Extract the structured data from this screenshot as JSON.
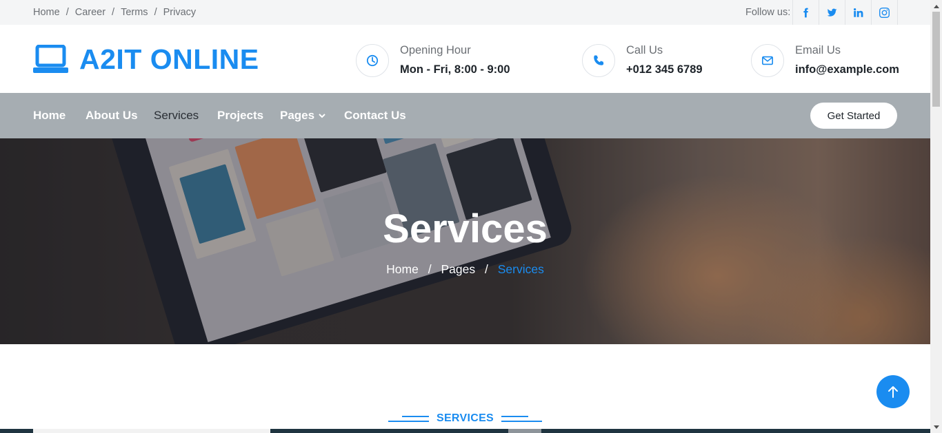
{
  "topbar": {
    "links": [
      "Home",
      "Career",
      "Terms",
      "Privacy"
    ],
    "separator": "/",
    "follow_label": "Follow us:",
    "social": [
      "facebook-icon",
      "twitter-icon",
      "linkedin-icon",
      "instagram-icon"
    ]
  },
  "header": {
    "brand": "A2IT ONLINE",
    "opening": {
      "label": "Opening Hour",
      "value": "Mon - Fri, 8:00 - 9:00"
    },
    "call": {
      "label": "Call Us",
      "value": "+012 345 6789"
    },
    "email": {
      "label": "Email Us",
      "value": "info@example.com"
    }
  },
  "nav": {
    "items": [
      "Home",
      "About Us",
      "Services",
      "Projects",
      "Pages",
      "Contact Us"
    ],
    "active": "Services",
    "cta": "Get Started"
  },
  "hero": {
    "title": "Services",
    "breadcrumb": [
      "Home",
      "Pages",
      "Services"
    ],
    "separator": "/"
  },
  "section": {
    "label": "SERVICES"
  },
  "colors": {
    "accent": "#1a8cf0",
    "nav_bg": "#a6adb2"
  }
}
